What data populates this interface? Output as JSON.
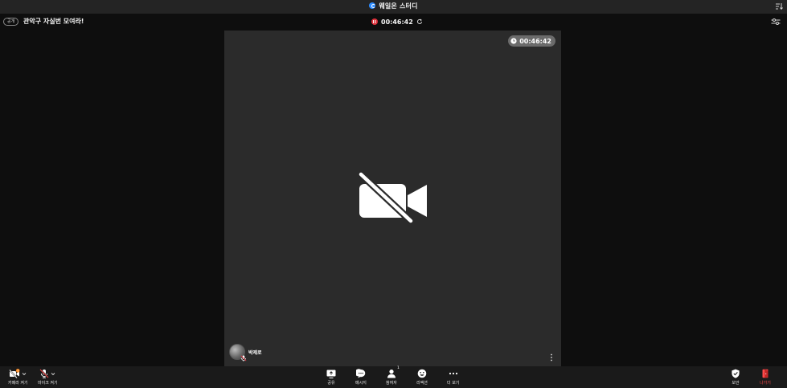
{
  "window": {
    "title": "웨일온 스터디"
  },
  "meeting": {
    "visibility_badge": "공개",
    "room_title": "관악구 자실번 모여라!",
    "recording_time": "00:46:42",
    "session_timer": "00:46:42"
  },
  "participant": {
    "name": "박제로"
  },
  "toolbar": {
    "camera_label": "카메라 켜기",
    "mic_label": "마이크 켜기",
    "share_label": "공유",
    "message_label": "메시지",
    "participants_label": "참여자",
    "participants_count": "1",
    "reaction_label": "리액션",
    "more_label": "더 보기",
    "security_label": "보안",
    "leave_label": "나가기"
  },
  "colors": {
    "accent": "#2d8cff",
    "recording": "#e0313b",
    "leave": "#ff4a4a",
    "video_bg": "#2b2b2b",
    "toolbar_bg": "#1a1a1a"
  },
  "icons": {
    "window_badge": "whale-icon",
    "corner": "sort-icon",
    "recording": "pause-recording-icon",
    "refresh": "refresh-icon",
    "settings": "sliders-icon",
    "timer": "clock-icon",
    "camera_off": "video-off-icon",
    "participant_mic": "mic-off-icon",
    "more_vertical": "more-vertical-icon",
    "camera": "camera-off-icon",
    "mic": "mic-off-icon",
    "share": "screen-share-icon",
    "message": "chat-icon",
    "participants": "person-icon",
    "reaction": "smile-icon",
    "more": "more-horizontal-icon",
    "security": "shield-icon",
    "leave": "exit-icon"
  }
}
